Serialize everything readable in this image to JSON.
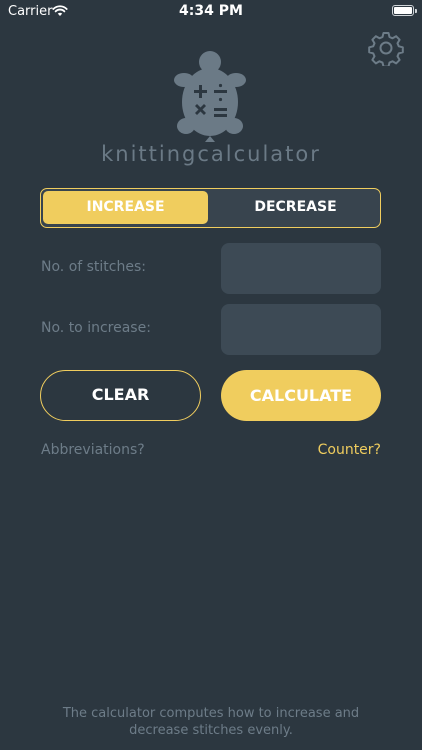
{
  "status_bar": {
    "carrier": "Carrier",
    "time": "4:34 PM"
  },
  "header": {
    "app_title": "knittingcalculator"
  },
  "mode": {
    "increase_label": "INCREASE",
    "decrease_label": "DECREASE",
    "selected": "INCREASE"
  },
  "fields": {
    "stitches_label": "No. of stitches:",
    "stitches_value": "",
    "increase_label": "No. to increase:",
    "increase_value": ""
  },
  "actions": {
    "clear_label": "CLEAR",
    "calculate_label": "CALCULATE"
  },
  "links": {
    "abbreviations": "Abbreviations?",
    "counter": "Counter?"
  },
  "footer": {
    "line1": "The calculator computes how to increase and",
    "line2": "decrease stitches evenly."
  },
  "colors": {
    "background": "#2c3740",
    "accent": "#f0cd5e",
    "muted": "#6d7c88",
    "field": "#3d4a55"
  },
  "icons": [
    "wifi-icon",
    "battery-icon",
    "gear-icon",
    "turtle-logo-icon"
  ]
}
